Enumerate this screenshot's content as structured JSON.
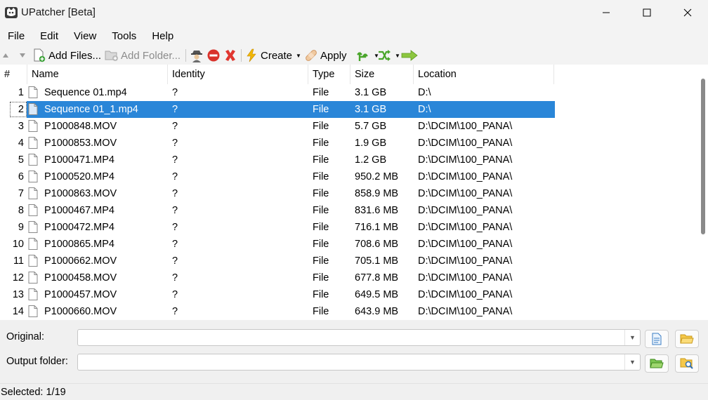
{
  "window": {
    "title": "UPatcher [Beta]"
  },
  "menu": [
    "File",
    "Edit",
    "View",
    "Tools",
    "Help"
  ],
  "toolbar": {
    "add_files": "Add Files...",
    "add_folder": "Add Folder...",
    "create": "Create",
    "apply": "Apply"
  },
  "table": {
    "headers": [
      "#",
      "Name",
      "Identity",
      "Type",
      "Size",
      "Location"
    ],
    "rows": [
      {
        "num": "1",
        "name": "Sequence 01.mp4",
        "identity": "?",
        "type": "File",
        "size": "3.1 GB",
        "location": "D:\\"
      },
      {
        "num": "2",
        "name": "Sequence 01_1.mp4",
        "identity": "?",
        "type": "File",
        "size": "3.1 GB",
        "location": "D:\\"
      },
      {
        "num": "3",
        "name": "P1000848.MOV",
        "identity": "?",
        "type": "File",
        "size": "5.7 GB",
        "location": "D:\\DCIM\\100_PANA\\"
      },
      {
        "num": "4",
        "name": "P1000853.MOV",
        "identity": "?",
        "type": "File",
        "size": "1.9 GB",
        "location": "D:\\DCIM\\100_PANA\\"
      },
      {
        "num": "5",
        "name": "P1000471.MP4",
        "identity": "?",
        "type": "File",
        "size": "1.2 GB",
        "location": "D:\\DCIM\\100_PANA\\"
      },
      {
        "num": "6",
        "name": "P1000520.MP4",
        "identity": "?",
        "type": "File",
        "size": "950.2 MB",
        "location": "D:\\DCIM\\100_PANA\\"
      },
      {
        "num": "7",
        "name": "P1000863.MOV",
        "identity": "?",
        "type": "File",
        "size": "858.9 MB",
        "location": "D:\\DCIM\\100_PANA\\"
      },
      {
        "num": "8",
        "name": "P1000467.MP4",
        "identity": "?",
        "type": "File",
        "size": "831.6 MB",
        "location": "D:\\DCIM\\100_PANA\\"
      },
      {
        "num": "9",
        "name": "P1000472.MP4",
        "identity": "?",
        "type": "File",
        "size": "716.1 MB",
        "location": "D:\\DCIM\\100_PANA\\"
      },
      {
        "num": "10",
        "name": "P1000865.MP4",
        "identity": "?",
        "type": "File",
        "size": "708.6 MB",
        "location": "D:\\DCIM\\100_PANA\\"
      },
      {
        "num": "11",
        "name": "P1000662.MOV",
        "identity": "?",
        "type": "File",
        "size": "705.1 MB",
        "location": "D:\\DCIM\\100_PANA\\"
      },
      {
        "num": "12",
        "name": "P1000458.MOV",
        "identity": "?",
        "type": "File",
        "size": "677.8 MB",
        "location": "D:\\DCIM\\100_PANA\\"
      },
      {
        "num": "13",
        "name": "P1000457.MOV",
        "identity": "?",
        "type": "File",
        "size": "649.5 MB",
        "location": "D:\\DCIM\\100_PANA\\"
      },
      {
        "num": "14",
        "name": "P1000660.MOV",
        "identity": "?",
        "type": "File",
        "size": "643.9 MB",
        "location": "D:\\DCIM\\100_PANA\\"
      }
    ],
    "selected_row": "2"
  },
  "bottom": {
    "original_label": "Original:",
    "original_value": "",
    "output_label": "Output folder:",
    "output_value": ""
  },
  "status": {
    "text": "Selected: 1/19"
  },
  "colors": {
    "selection": "#2a86d8",
    "accent_green": "#49a52a",
    "accent_red": "#d9322b"
  }
}
